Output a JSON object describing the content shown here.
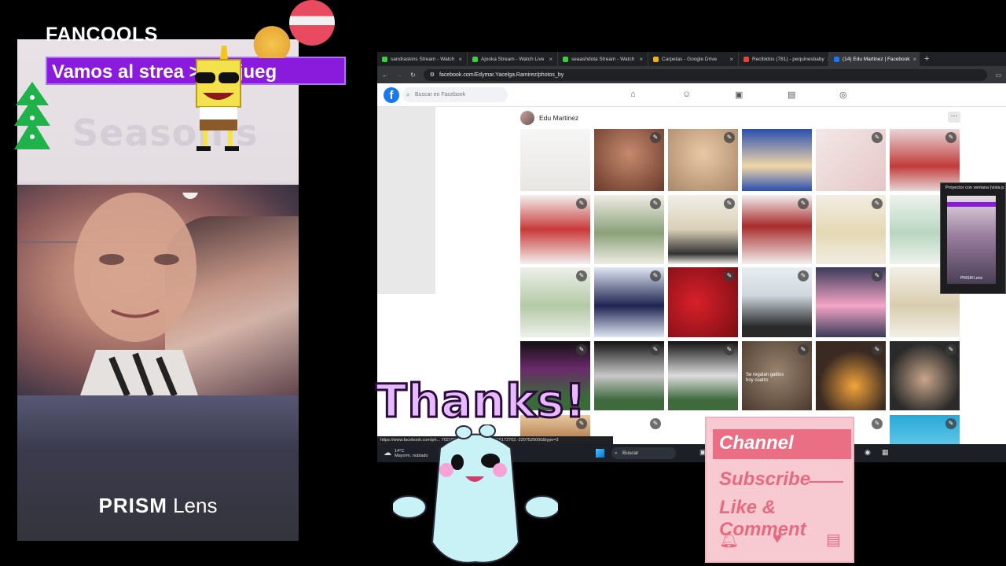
{
  "overlay": {
    "brand": "FANCOOLS",
    "marquee": "Vamos al strea          > del jueg",
    "season_bg": "Season's",
    "lens_bold": "PRISM",
    "lens_rest": " Lens",
    "thanks": "Thanks!",
    "subscribe_card": {
      "channel": "Channel",
      "subscribe": "Subscribe",
      "like_comment": "Like & Comment"
    }
  },
  "browser": {
    "tabs": [
      {
        "label": "sandraskins Stream - Watch",
        "color": "#3ecf3e",
        "active": false
      },
      {
        "label": "Ajooka Stream - Watch Live",
        "color": "#3ecf3e",
        "active": false
      },
      {
        "label": "seaashdota Stream - Watch",
        "color": "#3ecf3e",
        "active": false
      },
      {
        "label": "Carpetas - Google Drive",
        "color": "#f4b400",
        "active": false
      },
      {
        "label": "Recibidos (781) - pequinesbaby",
        "color": "#ea4335",
        "active": false
      },
      {
        "label": "(14) Edu Martinez | Facebook",
        "color": "#1877f2",
        "active": true
      }
    ],
    "url": "facebook.com/Edymar.Yacelga.Ramirez/photos_by",
    "search_placeholder": "Buscar en Facebook",
    "profile_name": "Edu Martinez",
    "status_url": "https://www.facebook.com/ph...          7021899238set=pb.100004736172702.-2207520000&type=3",
    "photo_captions": [
      "Se regalan gatitos",
      "hoy cuatro"
    ],
    "taskbar": {
      "temp": "14°C",
      "weather": "Mayorm. nublado",
      "search": "Buscar"
    },
    "popup_title": "Proyector con ventana (vista p..."
  }
}
